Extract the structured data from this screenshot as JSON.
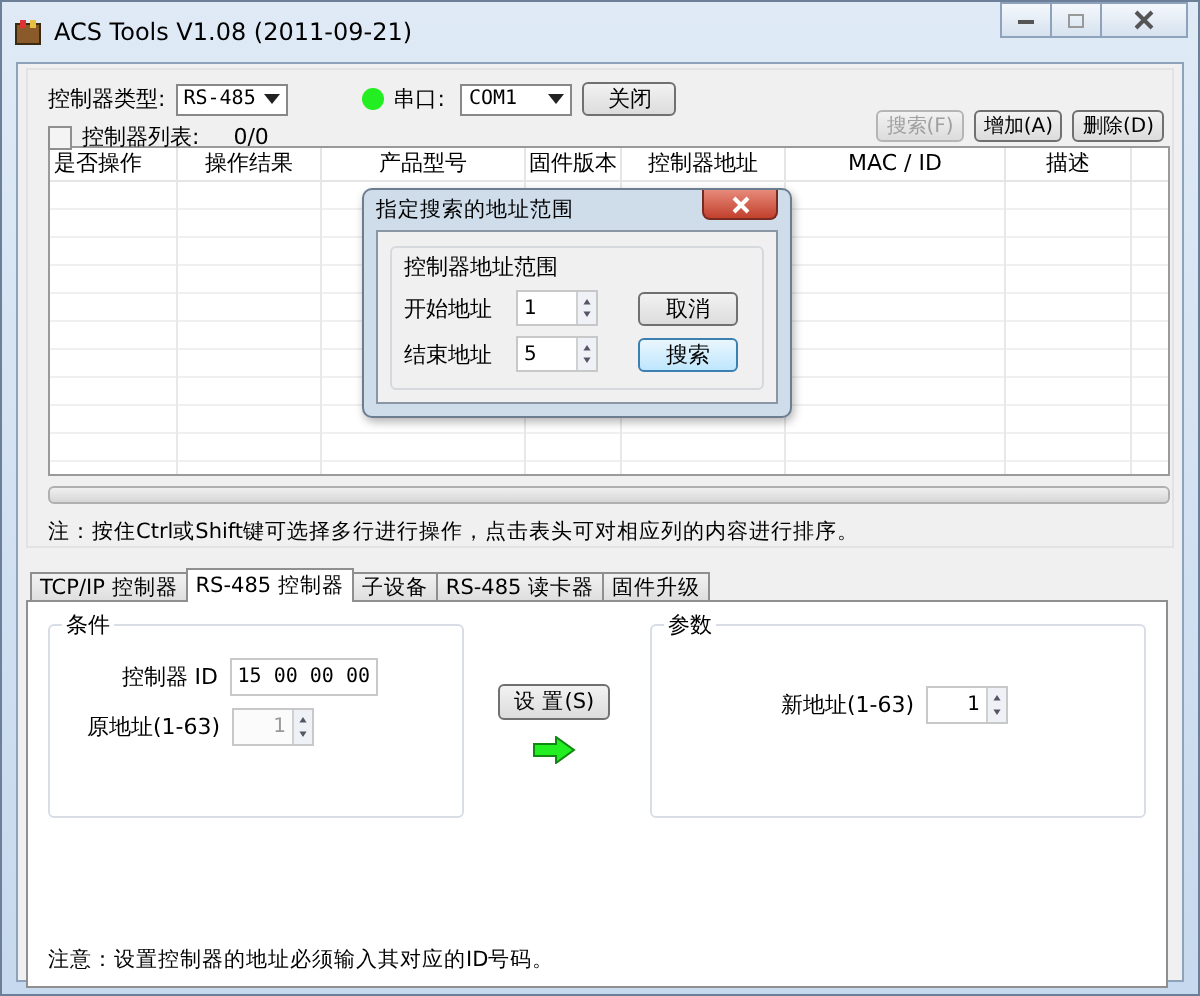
{
  "window": {
    "title": "ACS Tools V1.08 (2011-09-21)"
  },
  "toolbar": {
    "type_label": "控制器类型:",
    "type_value": "RS-485",
    "port_connected": true,
    "port_label": "串口:",
    "port_value": "COM1",
    "close_button": "关闭",
    "list_checkbox": {
      "label": "控制器列表:",
      "checked": false
    },
    "count": "0/0",
    "buttons": [
      {
        "label": "搜索(F)",
        "disabled": true
      },
      {
        "label": "增加(A)",
        "disabled": false
      },
      {
        "label": "删除(D)",
        "disabled": false
      }
    ]
  },
  "table": {
    "columns": [
      "是否操作",
      "操作结果",
      "产品型号",
      "固件版本",
      "控制器地址",
      "MAC / ID",
      "描述"
    ]
  },
  "hint": "注：按住Ctrl或Shift键可选择多行进行操作，点击表头可对相应列的内容进行排序。",
  "dialog": {
    "title": "指定搜索的地址范围",
    "group": "控制器地址范围",
    "fields": [
      {
        "label": "开始地址",
        "value": "1"
      },
      {
        "label": "结束地址",
        "value": "5"
      }
    ],
    "buttons": [
      {
        "label": "取消",
        "default": false
      },
      {
        "label": "搜索",
        "default": true
      }
    ]
  },
  "tabs": [
    {
      "label": "TCP/IP 控制器",
      "selected": false
    },
    {
      "label": "RS-485 控制器",
      "selected": true
    },
    {
      "label": "子设备",
      "selected": false
    },
    {
      "label": "RS-485 读卡器",
      "selected": false
    },
    {
      "label": "固件升级",
      "selected": false
    }
  ],
  "conditions": {
    "title": "条件",
    "fields": [
      {
        "label": "控制器 ID",
        "value": "15 00 00 00",
        "kind": "text",
        "disabled": false
      },
      {
        "label": "原地址(1-63)",
        "value": "1",
        "kind": "spin",
        "disabled": true
      }
    ]
  },
  "set_button": "设 置(S)",
  "params": {
    "title": "参数",
    "fields": [
      {
        "label": "新地址(1-63)",
        "value": "1",
        "kind": "spin",
        "disabled": false
      }
    ]
  },
  "footer_note": "注意：设置控制器的地址必须输入其对应的ID号码。"
}
